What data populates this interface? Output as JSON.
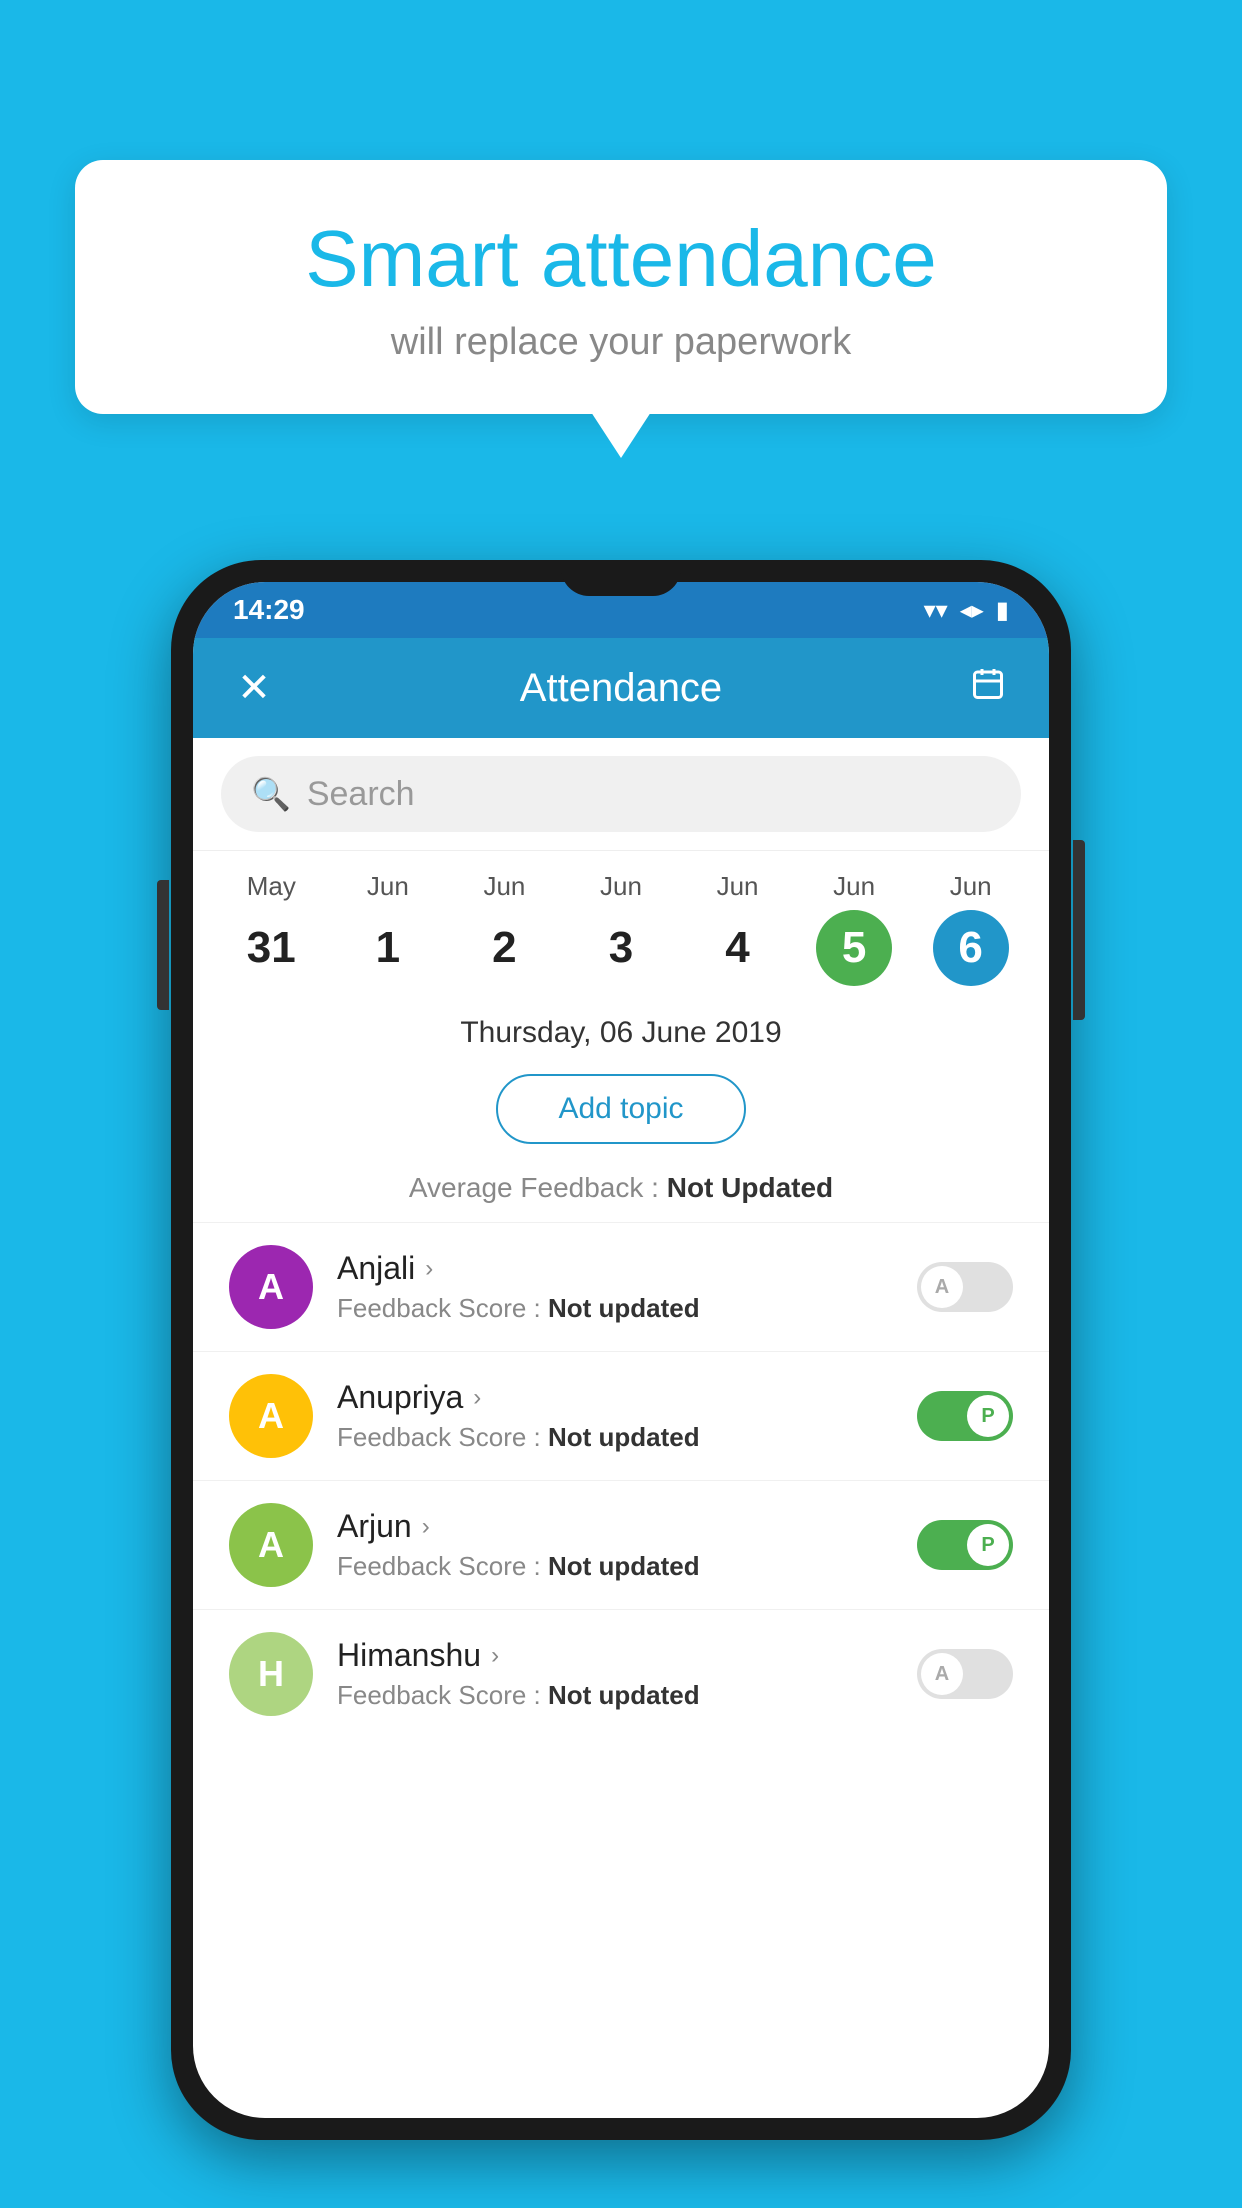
{
  "background_color": "#1ab8e8",
  "bubble": {
    "title": "Smart attendance",
    "subtitle": "will replace your paperwork"
  },
  "status_bar": {
    "time": "14:29",
    "wifi": "▼",
    "signal": "▲",
    "battery": "▮"
  },
  "app_bar": {
    "title": "Attendance",
    "close_label": "✕",
    "calendar_icon": "📅"
  },
  "search": {
    "placeholder": "Search"
  },
  "calendar": {
    "dates": [
      {
        "month": "May",
        "day": "31",
        "state": "normal"
      },
      {
        "month": "Jun",
        "day": "1",
        "state": "normal"
      },
      {
        "month": "Jun",
        "day": "2",
        "state": "normal"
      },
      {
        "month": "Jun",
        "day": "3",
        "state": "normal"
      },
      {
        "month": "Jun",
        "day": "4",
        "state": "normal"
      },
      {
        "month": "Jun",
        "day": "5",
        "state": "today"
      },
      {
        "month": "Jun",
        "day": "6",
        "state": "selected"
      }
    ]
  },
  "selected_date": "Thursday, 06 June 2019",
  "add_topic_label": "Add topic",
  "avg_feedback_prefix": "Average Feedback : ",
  "avg_feedback_value": "Not Updated",
  "students": [
    {
      "name": "Anjali",
      "avatar_letter": "A",
      "avatar_color": "#9c27b0",
      "feedback_label": "Feedback Score : ",
      "feedback_value": "Not updated",
      "toggle_state": "off",
      "toggle_letter": "A"
    },
    {
      "name": "Anupriya",
      "avatar_letter": "A",
      "avatar_color": "#ffc107",
      "feedback_label": "Feedback Score : ",
      "feedback_value": "Not updated",
      "toggle_state": "on",
      "toggle_letter": "P"
    },
    {
      "name": "Arjun",
      "avatar_letter": "A",
      "avatar_color": "#8bc34a",
      "feedback_label": "Feedback Score : ",
      "feedback_value": "Not updated",
      "toggle_state": "on",
      "toggle_letter": "P"
    },
    {
      "name": "Himanshu",
      "avatar_letter": "H",
      "avatar_color": "#aed581",
      "feedback_label": "Feedback Score : ",
      "feedback_value": "Not updated",
      "toggle_state": "off",
      "toggle_letter": "A"
    }
  ]
}
